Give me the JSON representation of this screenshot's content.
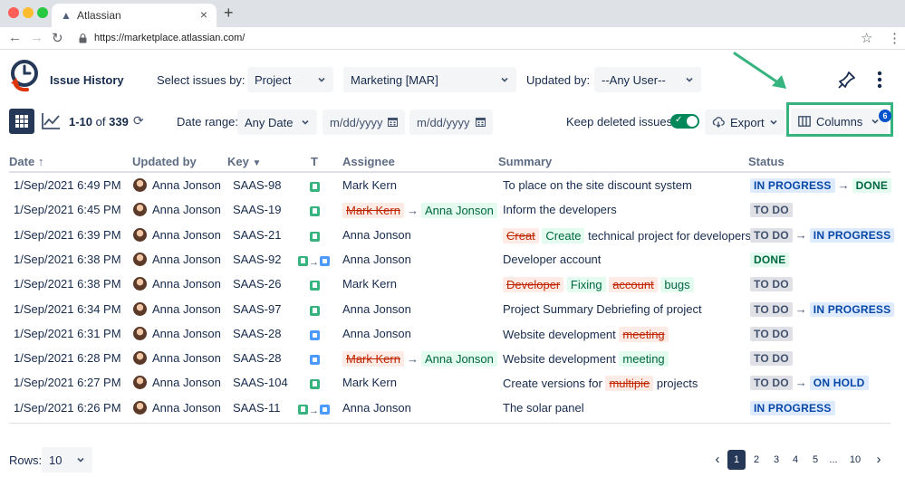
{
  "browser": {
    "tab_title": "Atlassian",
    "tab_close": "×",
    "new_tab": "+",
    "url": "https://marketplace.atlassian.com/",
    "icons": [
      "back-arrow-icon",
      "forward-arrow-icon",
      "reload-icon",
      "lock-icon",
      "star-icon",
      "menu-icon"
    ]
  },
  "app": {
    "title": "Issue History",
    "accent": "#de350b",
    "brand_dark": "#253858"
  },
  "filters": {
    "select_by_label": "Select issues by:",
    "select_by_value": "Project",
    "project_value": "Marketing [MAR]",
    "updated_by_label": "Updated by:",
    "updated_by_value": "--Any User--"
  },
  "toolbar": {
    "range_shown": "1-10",
    "range_of": "of",
    "range_total": "339",
    "date_range_label": "Date range:",
    "date_range_value": "Any Date",
    "date_from_placeholder": "m/dd/yyyy",
    "date_to_placeholder": "m/dd/yyyy",
    "keep_deleted_label": "Keep deleted issues",
    "keep_deleted_on": true,
    "export_label": "Export",
    "columns_label": "Columns",
    "columns_badge": "6",
    "highlight_color": "#36b37e"
  },
  "table": {
    "headers": {
      "date": "Date",
      "updated_by": "Updated by",
      "key": "Key",
      "type": "T",
      "assignee": "Assignee",
      "summary": "Summary",
      "status": "Status"
    },
    "rows": [
      {
        "date": "1/Sep/2021 6:49 PM",
        "updated_by": "Anna Jonson",
        "key": "SAAS-98",
        "type": [
          "story"
        ],
        "assignee": [
          {
            "text": "Mark Kern",
            "kind": "plain"
          }
        ],
        "summary": [
          {
            "text": "To place on the site discount system",
            "kind": "plain"
          }
        ],
        "status": [
          {
            "text": "IN PROGRESS",
            "kind": "inprog"
          },
          {
            "text": "DONE",
            "kind": "done"
          }
        ]
      },
      {
        "date": "1/Sep/2021 6:45 PM",
        "updated_by": "Anna Jonson",
        "key": "SAAS-19",
        "type": [
          "story"
        ],
        "assignee": [
          {
            "text": "Mark Kern",
            "kind": "del"
          },
          {
            "text": "Anna Jonson",
            "kind": "add"
          }
        ],
        "summary": [
          {
            "text": "Inform the developers",
            "kind": "plain"
          }
        ],
        "status": [
          {
            "text": "TO DO",
            "kind": "todo"
          }
        ]
      },
      {
        "date": "1/Sep/2021 6:39 PM",
        "updated_by": "Anna Jonson",
        "key": "SAAS-21",
        "type": [
          "story"
        ],
        "assignee": [
          {
            "text": "Anna Jonson",
            "kind": "plain"
          }
        ],
        "summary": [
          {
            "text": "Creat",
            "kind": "del"
          },
          {
            "text": "Create",
            "kind": "add"
          },
          {
            "text": "technical project for developers",
            "kind": "plain"
          }
        ],
        "status": [
          {
            "text": "TO DO",
            "kind": "todo"
          },
          {
            "text": "IN PROGRESS",
            "kind": "inprog"
          }
        ]
      },
      {
        "date": "1/Sep/2021 6:38 PM",
        "updated_by": "Anna Jonson",
        "key": "SAAS-92",
        "type": [
          "story",
          "task"
        ],
        "assignee": [
          {
            "text": "Anna Jonson",
            "kind": "plain"
          }
        ],
        "summary": [
          {
            "text": "Developer account",
            "kind": "plain"
          }
        ],
        "status": [
          {
            "text": "DONE",
            "kind": "done"
          }
        ]
      },
      {
        "date": "1/Sep/2021 6:38 PM",
        "updated_by": "Anna Jonson",
        "key": "SAAS-26",
        "type": [
          "story"
        ],
        "assignee": [
          {
            "text": "Mark Kern",
            "kind": "plain"
          }
        ],
        "summary": [
          {
            "text": "Developer",
            "kind": "del"
          },
          {
            "text": "Fixing",
            "kind": "add"
          },
          {
            "text": "account",
            "kind": "del"
          },
          {
            "text": "bugs",
            "kind": "add"
          }
        ],
        "status": [
          {
            "text": "TO DO",
            "kind": "todo"
          }
        ]
      },
      {
        "date": "1/Sep/2021 6:34 PM",
        "updated_by": "Anna Jonson",
        "key": "SAAS-97",
        "type": [
          "story"
        ],
        "assignee": [
          {
            "text": "Anna Jonson",
            "kind": "plain"
          }
        ],
        "summary": [
          {
            "text": "Project Summary Debriefing of project",
            "kind": "plain"
          }
        ],
        "status": [
          {
            "text": "TO DO",
            "kind": "todo"
          },
          {
            "text": "IN PROGRESS",
            "kind": "inprog"
          }
        ]
      },
      {
        "date": "1/Sep/2021 6:31 PM",
        "updated_by": "Anna Jonson",
        "key": "SAAS-28",
        "type": [
          "task"
        ],
        "assignee": [
          {
            "text": "Anna Jonson",
            "kind": "plain"
          }
        ],
        "summary": [
          {
            "text": "Website development",
            "kind": "plain"
          },
          {
            "text": "meeting",
            "kind": "del"
          }
        ],
        "status": [
          {
            "text": "TO DO",
            "kind": "todo"
          }
        ]
      },
      {
        "date": "1/Sep/2021 6:28 PM",
        "updated_by": "Anna Jonson",
        "key": "SAAS-28",
        "type": [
          "task"
        ],
        "assignee": [
          {
            "text": "Mark Kern",
            "kind": "del"
          },
          {
            "text": "Anna Jonson",
            "kind": "add"
          }
        ],
        "summary": [
          {
            "text": "Website development",
            "kind": "plain"
          },
          {
            "text": "meeting",
            "kind": "add"
          }
        ],
        "status": [
          {
            "text": "TO DO",
            "kind": "todo"
          }
        ]
      },
      {
        "date": "1/Sep/2021 6:27 PM",
        "updated_by": "Anna Jonson",
        "key": "SAAS-104",
        "type": [
          "story"
        ],
        "assignee": [
          {
            "text": "Mark Kern",
            "kind": "plain"
          }
        ],
        "summary": [
          {
            "text": "Create versions for",
            "kind": "plain"
          },
          {
            "text": "multipie",
            "kind": "del"
          },
          {
            "text": "projects",
            "kind": "plain"
          }
        ],
        "status": [
          {
            "text": "TO DO",
            "kind": "todo"
          },
          {
            "text": "ON HOLD",
            "kind": "hold"
          }
        ]
      },
      {
        "date": "1/Sep/2021 6:26 PM",
        "updated_by": "Anna Jonson",
        "key": "SAAS-11",
        "type": [
          "story",
          "task"
        ],
        "assignee": [
          {
            "text": "Anna Jonson",
            "kind": "plain"
          }
        ],
        "summary": [
          {
            "text": "The solar panel",
            "kind": "plain"
          }
        ],
        "status": [
          {
            "text": "IN PROGRESS",
            "kind": "inprog"
          }
        ]
      }
    ]
  },
  "footer": {
    "rows_label": "Rows:",
    "rows_value": "10",
    "pages": [
      "1",
      "2",
      "3",
      "4",
      "5",
      "...",
      "10"
    ],
    "active_page": "1",
    "prev": "‹",
    "next": "›"
  }
}
